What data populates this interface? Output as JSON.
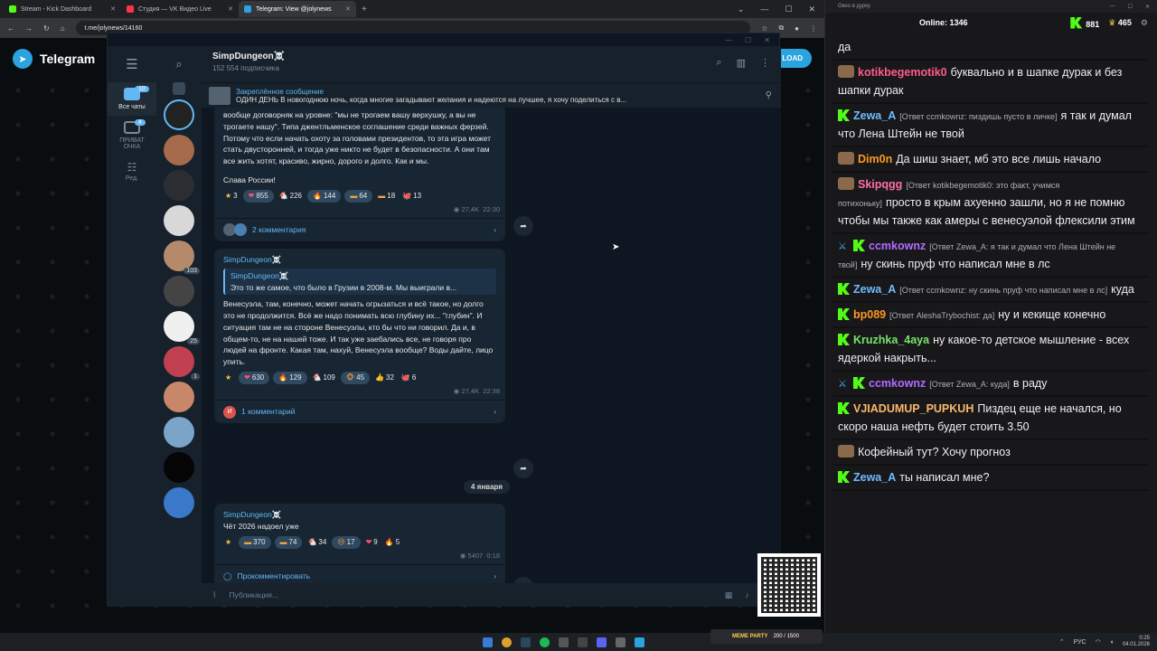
{
  "browser": {
    "tabs": [
      {
        "title": "Stream - Kick Dashboard",
        "color": "#53fc18"
      },
      {
        "title": "Студия — VK Видео Live",
        "color": "#ff3347"
      },
      {
        "title": "Telegram: View @jolynews",
        "color": "#2aa3df"
      }
    ],
    "url": "t.me/jolynews/14160"
  },
  "tgweb": {
    "logo": "Telegram",
    "download_btn": "LOAD"
  },
  "telegram": {
    "folders": [
      {
        "label": "Все чаты",
        "badge": "10"
      },
      {
        "label": "ПРИВАТ ОЧКА",
        "badge": "4"
      },
      {
        "label": "Ред.",
        "badge": ""
      }
    ],
    "chat_list_counts": [
      "103",
      "25",
      "1"
    ],
    "channel": {
      "title": "SimpDungeon☠️",
      "subscribers": "152 554 подписчика"
    },
    "pinned": {
      "title": "Закреплённое сообщение",
      "text": "ОДИН ДЕНЬ  В новогоднюю ночь, когда многие загадывают желания и надеются на лучшее, я хочу поделиться с в..."
    },
    "posts": [
      {
        "text": "вообще договорняк на уровне: \"мы не трогаем вашу верхушку, а вы не трогаете нашу\". Типа джентльменское соглашение среди важных ферзей. Потому что если начать охоту за головами президентов, то эта игра может стать двусторонней, и тогда уже никто не будет в безопасности. А они там все жить хотят, красиво, жирно, дорого и долго. Как и мы.",
        "text2": "Слава России!",
        "reactions": [
          {
            "icon": "★",
            "count": "3",
            "plain": true
          },
          {
            "icon": "❤",
            "count": "855"
          },
          {
            "icon": "🐔",
            "count": "226",
            "plain": true
          },
          {
            "icon": "🔥",
            "count": "144"
          },
          {
            "icon": "▬",
            "count": "64"
          },
          {
            "icon": "▬",
            "count": "18",
            "plain": true
          },
          {
            "icon": "🐙",
            "count": "13",
            "plain": true
          }
        ],
        "views": "27,4K",
        "time": "22:30",
        "comments": "2 комментария"
      },
      {
        "author": "SimpDungeon☠️",
        "quote_author": "SimpDungeon☠️",
        "quote_text": "Это то же самое, что было в Грузии в 2008-м. Мы выиграли в...",
        "text": "Венесуэла, там, конечно, может начать огрызаться и всё такое, но долго это не продолжится. Всё же надо понимать всю глубину их... \"глубин\". И ситуация там не на стороне Венесуэлы, кто бы что ни говорил. Да и, в общем-то, не на нашей тоже. И так уже заебались все, не говоря про людей на фронте. Какая там, нахуй, Венесуэла вообще? Воды дайте, лицо упить.",
        "reactions": [
          {
            "icon": "★",
            "count": "",
            "plain": true
          },
          {
            "icon": "❤",
            "count": "630"
          },
          {
            "icon": "🔥",
            "count": "129"
          },
          {
            "icon": "🐔",
            "count": "109",
            "plain": true
          },
          {
            "icon": "🐵",
            "count": "45"
          },
          {
            "icon": "👍",
            "count": "32",
            "plain": true
          },
          {
            "icon": "🐙",
            "count": "6",
            "plain": true
          }
        ],
        "views": "27,4K",
        "time": "22:38",
        "comments": "1 комментарий",
        "comment_avatar": "И"
      },
      {
        "author": "SimpDungeon☠️",
        "text": "Чёт 2026 надоел уже",
        "reactions": [
          {
            "icon": "★",
            "count": "",
            "plain": true
          },
          {
            "icon": "▬",
            "count": "370"
          },
          {
            "icon": "▬",
            "count": "74"
          },
          {
            "icon": "🐔",
            "count": "34",
            "plain": true
          },
          {
            "icon": "😢",
            "count": "17"
          },
          {
            "icon": "❤",
            "count": "9",
            "plain": true
          },
          {
            "icon": "🔥",
            "count": "5",
            "plain": true
          }
        ],
        "views": "5407",
        "time": "0:18",
        "comments": "Прокомментировать"
      }
    ],
    "date_separator": "4 января",
    "input_placeholder": "Публикация..."
  },
  "kick_chat": {
    "window_title": "Окно в дурку",
    "online_label": "Online:",
    "online": "1346",
    "followers": "881",
    "subs": "465",
    "top_text": "да",
    "messages": [
      {
        "user": "kotikbegemotik0",
        "color": "#ff5b8a",
        "badge": "avatar",
        "reply": "",
        "text": "буквально и в шапке дурак и без шапки дурак"
      },
      {
        "user": "Zewa_A",
        "color": "#6fbcff",
        "badge": "kick",
        "reply": "[Ответ ccmkownz: пиздишь пусто в личке]",
        "text": "я так и думал что Лена Штейн не твой"
      },
      {
        "user": "Dim0n",
        "color": "#ff9a1f",
        "badge": "avatar",
        "reply": "",
        "text": "Да шиш знает, мб это все лишь начало"
      },
      {
        "user": "Skipqgg",
        "color": "#ff6fa0",
        "badge": "avatar",
        "reply": "[Ответ kotikbegemotik0: это факт, учимся потихоньку]",
        "text": "просто в крым ахуенно зашли, но я не помню чтобы мы также как амеры с венесуэлой флексили этим"
      },
      {
        "user": "ccmkownz",
        "color": "#b36bff",
        "badge": "both",
        "reply": "[Ответ Zewa_A: я так и думал что Лена Штейн не твой]",
        "text": "ну скинь пруф что написал мне в лс"
      },
      {
        "user": "Zewa_A",
        "color": "#6fbcff",
        "badge": "kick",
        "reply": "[Ответ ccmkownz: ну скинь пруф что написал мне в лс]",
        "text": "куда"
      },
      {
        "user": "bp089",
        "color": "#ff9a1f",
        "badge": "kick",
        "reply": "[Ответ AleshaTrybochist: да]",
        "text": "ну и кекище конечно"
      },
      {
        "user": "Kruzhka_4aya",
        "color": "#79e36b",
        "badge": "kick",
        "reply": "",
        "text": "ну какое-то детское мышление - всех ядеркой накрыть..."
      },
      {
        "user": "ccmkownz",
        "color": "#b36bff",
        "badge": "both",
        "reply": "[Ответ Zewa_A: куда]",
        "text": "в раду"
      },
      {
        "user": "VJIADUMUP_PUPKUH",
        "color": "#ffb86b",
        "badge": "kick",
        "reply": "",
        "text": "Пиздец еще не начался, но скоро наша нефть будет стоить 3.50"
      },
      {
        "user": "",
        "color": "#ffffff",
        "badge": "avatar",
        "reply": "",
        "text": "Кофейный тут? Хочу прогноз"
      },
      {
        "user": "Zewa_A",
        "color": "#6fbcff",
        "badge": "kick",
        "reply": "",
        "text": "ты написал мне?"
      }
    ]
  },
  "overlay": {
    "meme_label": "MEME PARTY",
    "meme_progress": "200 / 1500"
  },
  "taskbar": {
    "lang": "РУС",
    "time": "0:25",
    "date": "04.01.2026"
  }
}
